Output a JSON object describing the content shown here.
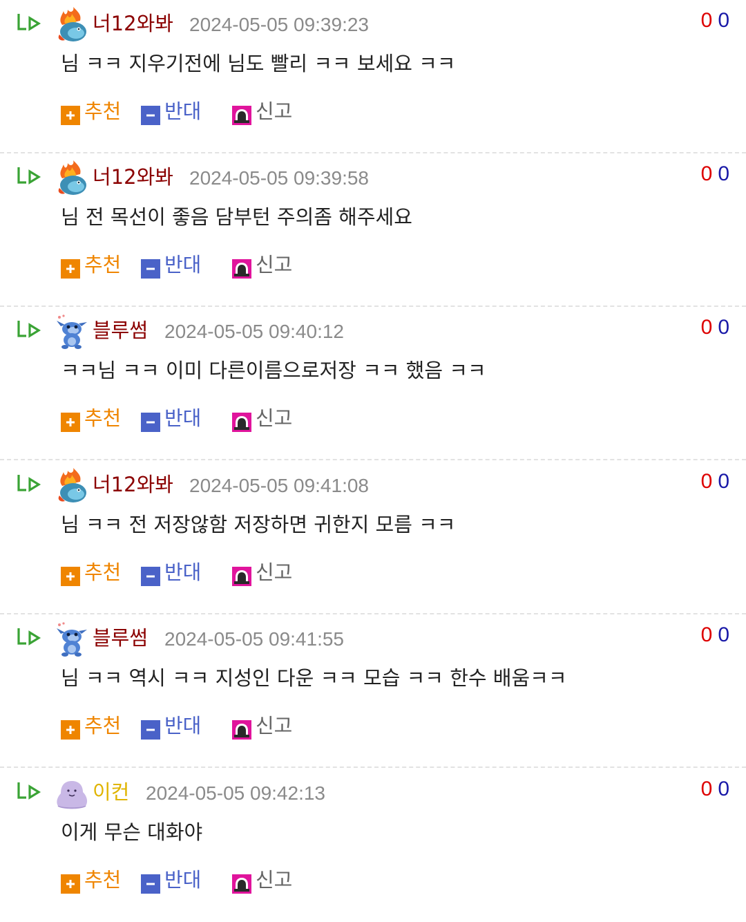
{
  "actions": {
    "recommend": "추천",
    "oppose": "반대",
    "report": "신고"
  },
  "colors": {
    "recommend": "#ef8500",
    "oppose": "#4a62c8",
    "report_box": "#e0149c",
    "reply_arrow": "#3aa335",
    "vote_up": "#dd0000",
    "vote_down": "#1a1aa8",
    "nick_dark_red": "#8b0000",
    "nick_gold": "#e0b400"
  },
  "comments": [
    {
      "nickname": "너12와봐",
      "avatar_icon": "fire-dragon-avatar-icon",
      "time": "2024-05-05 09:39:23",
      "text": "님 ㅋㅋ 지우기전에 님도 빨리 ㅋㅋ 보세요 ㅋㅋ",
      "up": "0",
      "down": "0"
    },
    {
      "nickname": "너12와봐",
      "avatar_icon": "fire-dragon-avatar-icon",
      "time": "2024-05-05 09:39:58",
      "text": "님 전 목선이 좋음 담부턴 주의좀 해주세요",
      "up": "0",
      "down": "0"
    },
    {
      "nickname": "블루썸",
      "avatar_icon": "blue-alien-avatar-icon",
      "time": "2024-05-05 09:40:12",
      "text": "ㅋㅋ님 ㅋㅋ 이미 다른이름으로저장 ㅋㅋ 했음 ㅋㅋ",
      "up": "0",
      "down": "0"
    },
    {
      "nickname": "너12와봐",
      "avatar_icon": "fire-dragon-avatar-icon",
      "time": "2024-05-05 09:41:08",
      "text": "님 ㅋㅋ 전 저장않함 저장하면 귀한지 모름 ㅋㅋ",
      "up": "0",
      "down": "0"
    },
    {
      "nickname": "블루썸",
      "avatar_icon": "blue-alien-avatar-icon",
      "time": "2024-05-05 09:41:55",
      "text": "님 ㅋㅋ 역시 ㅋㅋ 지성인 다운 ㅋㅋ 모습 ㅋㅋ 한수 배움ㅋㅋ",
      "up": "0",
      "down": "0"
    },
    {
      "nickname": "이컨",
      "avatar_icon": "purple-blob-avatar-icon",
      "time": "2024-05-05 09:42:13",
      "text": "이게 무슨 대화야",
      "up": "0",
      "down": "0"
    }
  ]
}
